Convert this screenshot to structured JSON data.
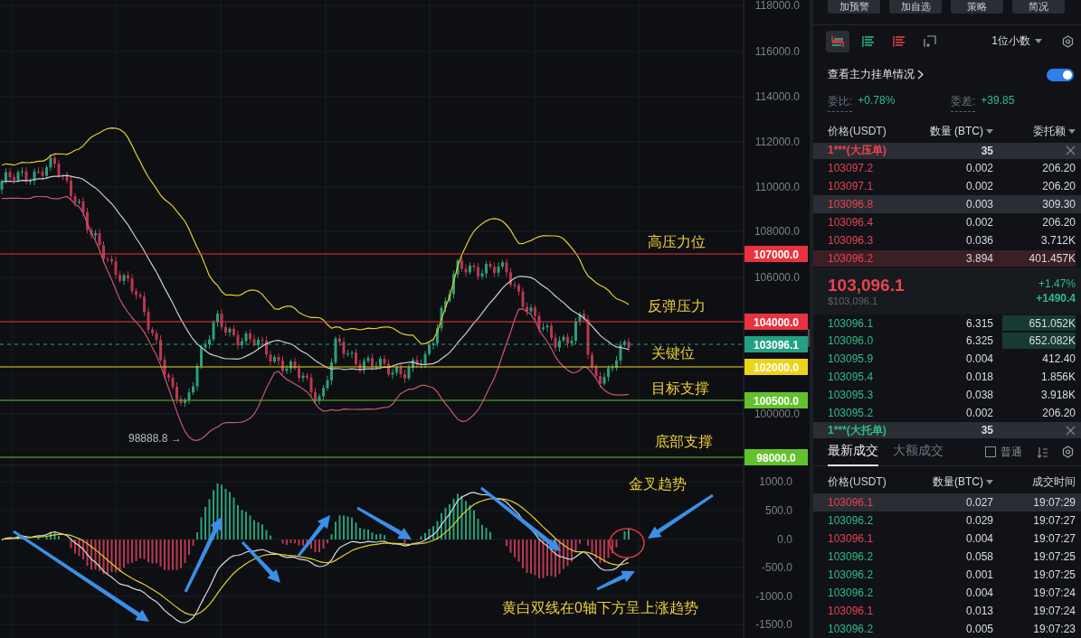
{
  "chart": {
    "price_axis": [
      "118000.0",
      "116000.0",
      "114000.0",
      "112000.0",
      "110000.0",
      "108000.0",
      "106000.0",
      "100000.0"
    ],
    "levels": [
      {
        "price": "107000.0",
        "color": "#e8333f",
        "note": "高压力位"
      },
      {
        "price": "104000.0",
        "color": "#e8333f",
        "note": "反弹压力"
      },
      {
        "price": "102000.0",
        "color": "#ecd41a",
        "note": "关键位"
      },
      {
        "price": "100500.0",
        "color": "#62c22c",
        "note": "目标支撑"
      },
      {
        "price": "98000.0",
        "color": "#62c22c",
        "note": "底部支撑"
      }
    ],
    "current_price": "103096.1",
    "low_label": "98888.8 →",
    "macd_axis": [
      "1000.0",
      "500.0",
      "0.0",
      "-500.0",
      "-1000.0",
      "-1500.0"
    ],
    "annotations": [
      "金叉趋势",
      "黄白双线在0轴下方呈上涨趋势"
    ]
  },
  "top_buttons": [
    "加预警",
    "加自选",
    "策略",
    "简况"
  ],
  "view_modes": [
    {
      "selected": true
    },
    {
      "selected": false
    },
    {
      "selected": false
    },
    {
      "selected": false
    }
  ],
  "precision": {
    "label": "1位小数"
  },
  "big_orders": {
    "label": "查看主力挂单情况",
    "on": true
  },
  "ratio": {
    "label": "委比:",
    "value": "+0.78%"
  },
  "diff": {
    "label": "委差:",
    "value": "+39.85"
  },
  "book_columns": [
    "价格(USDT)",
    "数量 (BTC)",
    "委托额"
  ],
  "ask_banner": {
    "label": "1***(大压单)",
    "count": "35"
  },
  "asks": [
    {
      "price": "103097.2",
      "qty": "0.002",
      "amount": "206.20",
      "highlighted": false
    },
    {
      "price": "103097.1",
      "qty": "0.002",
      "amount": "206.20",
      "highlighted": false
    },
    {
      "price": "103096.8",
      "qty": "0.003",
      "amount": "309.30",
      "highlighted": true
    },
    {
      "price": "103096.4",
      "qty": "0.002",
      "amount": "206.20",
      "highlighted": false
    },
    {
      "price": "103096.3",
      "qty": "0.036",
      "amount": "3.712K",
      "highlighted": false
    },
    {
      "price": "103096.2",
      "qty": "3.894",
      "amount": "401.457K",
      "level": 1,
      "highlighted": false
    }
  ],
  "mid": {
    "price": "103,096.1",
    "usd": "$103,096.1",
    "change_pct": "+1.47%",
    "change": "+1490.4"
  },
  "bids": [
    {
      "price": "103096.1",
      "qty": "6.315",
      "amount": "651.052K",
      "level": 0.28,
      "highlighted": false
    },
    {
      "price": "103096.0",
      "qty": "6.325",
      "amount": "652.082K",
      "level": 0.28,
      "highlighted": false
    },
    {
      "price": "103095.9",
      "qty": "0.004",
      "amount": "412.40",
      "highlighted": false
    },
    {
      "price": "103095.4",
      "qty": "0.018",
      "amount": "1.856K",
      "highlighted": false
    },
    {
      "price": "103095.3",
      "qty": "0.038",
      "amount": "3.918K",
      "highlighted": false
    },
    {
      "price": "103095.2",
      "qty": "0.002",
      "amount": "206.20",
      "highlighted": false
    }
  ],
  "bid_banner": {
    "label": "1***(大托单)",
    "count": "35"
  },
  "trade_tabs": [
    {
      "label": "最新成交",
      "selected": true
    },
    {
      "label": "大额成交",
      "selected": false
    }
  ],
  "normal_filter": {
    "label": "普通",
    "checked": false
  },
  "trade_columns": [
    "价格(USDT)",
    "数量(BTC)",
    "成交时间"
  ],
  "trades": [
    {
      "price": "103096.1",
      "qty": "0.027",
      "time": "19:07:29",
      "color": "#e8434f",
      "highlighted": true
    },
    {
      "price": "103096.2",
      "qty": "0.029",
      "time": "19:07:27",
      "color": "#2ebd85",
      "highlighted": false
    },
    {
      "price": "103096.1",
      "qty": "0.004",
      "time": "19:07:27",
      "color": "#e8434f",
      "highlighted": false
    },
    {
      "price": "103096.2",
      "qty": "0.058",
      "time": "19:07:25",
      "color": "#2ebd85",
      "highlighted": false
    },
    {
      "price": "103096.2",
      "qty": "0.001",
      "time": "19:07:25",
      "color": "#2ebd85",
      "highlighted": false
    },
    {
      "price": "103096.2",
      "qty": "0.004",
      "time": "19:07:24",
      "color": "#2ebd85",
      "highlighted": false
    },
    {
      "price": "103096.1",
      "qty": "0.013",
      "time": "19:07:24",
      "color": "#e8434f",
      "highlighted": false
    },
    {
      "price": "103096.2",
      "qty": "0.005",
      "time": "19:07:23",
      "color": "#2ebd85",
      "highlighted": false
    }
  ]
}
